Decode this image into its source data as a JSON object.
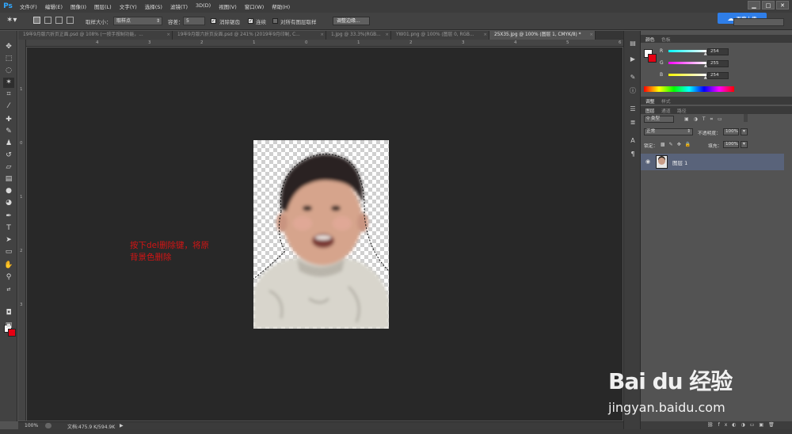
{
  "app": {
    "logo": "Ps"
  },
  "menus": [
    "文件(F)",
    "编辑(E)",
    "图像(I)",
    "图层(L)",
    "文字(Y)",
    "选择(S)",
    "滤镜(T)",
    "3D(D)",
    "视图(V)",
    "窗口(W)",
    "帮助(H)"
  ],
  "window_controls": {
    "minimize": "▁",
    "maximize": "□",
    "close": "✕"
  },
  "options": {
    "sample_size_label": "取样大小：",
    "sample_size_value": "取样点",
    "tolerance_label": "容差：",
    "tolerance_value": "5",
    "antialias_label": "消除锯齿",
    "contiguous_label": "连续",
    "sample_all_label": "对所有图层取样",
    "refine_edge_button": "调整边缘...",
    "antialias_checked": true,
    "contiguous_checked": true,
    "sample_all_checked": false
  },
  "baidu_upload": {
    "label": "百度上传"
  },
  "tabs": [
    "19年9月版六折页正面.psd @ 108% (一按手按制功能，...",
    "19年9月版六折页反面.psd @ 241% (2019年9月印制, C...",
    "1.jpg @ 33.3%(RGB...",
    "YW01.png @ 100% (图层 0, RGB...",
    "25X35.jpg @ 100% (图层 1, CMYK/8) *"
  ],
  "active_tab_index": 4,
  "ruler_ticks_top": [
    "4",
    "3",
    "2",
    "1",
    "0",
    "1",
    "2",
    "3",
    "4",
    "5",
    "6",
    "7"
  ],
  "ruler_ticks_left": [
    "1",
    "0",
    "1",
    "2",
    "3"
  ],
  "annotation": "按下del删除键，将原\n背景色删除",
  "status": {
    "zoom": "100%",
    "doc": "文档:475.9 K/594.9K"
  },
  "color_panel": {
    "tabs": [
      "颜色",
      "色板"
    ],
    "r_label": "R",
    "g_label": "G",
    "b_label": "B",
    "r_value": "254",
    "g_value": "255",
    "b_value": "254",
    "r_fraction": 0.996,
    "g_fraction": 1.0,
    "b_fraction": 0.996,
    "fg_color": "#ffffff",
    "bg_color": "#e50012"
  },
  "adjust_panel": {
    "tabs": [
      "调整",
      "样式"
    ]
  },
  "layers_panel": {
    "tabs": [
      "图层",
      "通道",
      "路径"
    ],
    "filter_label": "类型",
    "blend_mode": "正常",
    "opacity_label": "不透明度：",
    "opacity_value": "100%",
    "lock_label": "锁定：",
    "fill_label": "填充：",
    "fill_value": "100%",
    "layers": [
      {
        "name": "图层 1",
        "visible": true,
        "selected": true
      }
    ]
  },
  "watermark": {
    "logo": "Bai du 经验",
    "url": "jingyan.baidu.com"
  },
  "colors": {
    "accent": "#31a8ff",
    "annotation": "#d21515",
    "selected_layer": "#59637a",
    "canvas_bg": "#282828"
  }
}
